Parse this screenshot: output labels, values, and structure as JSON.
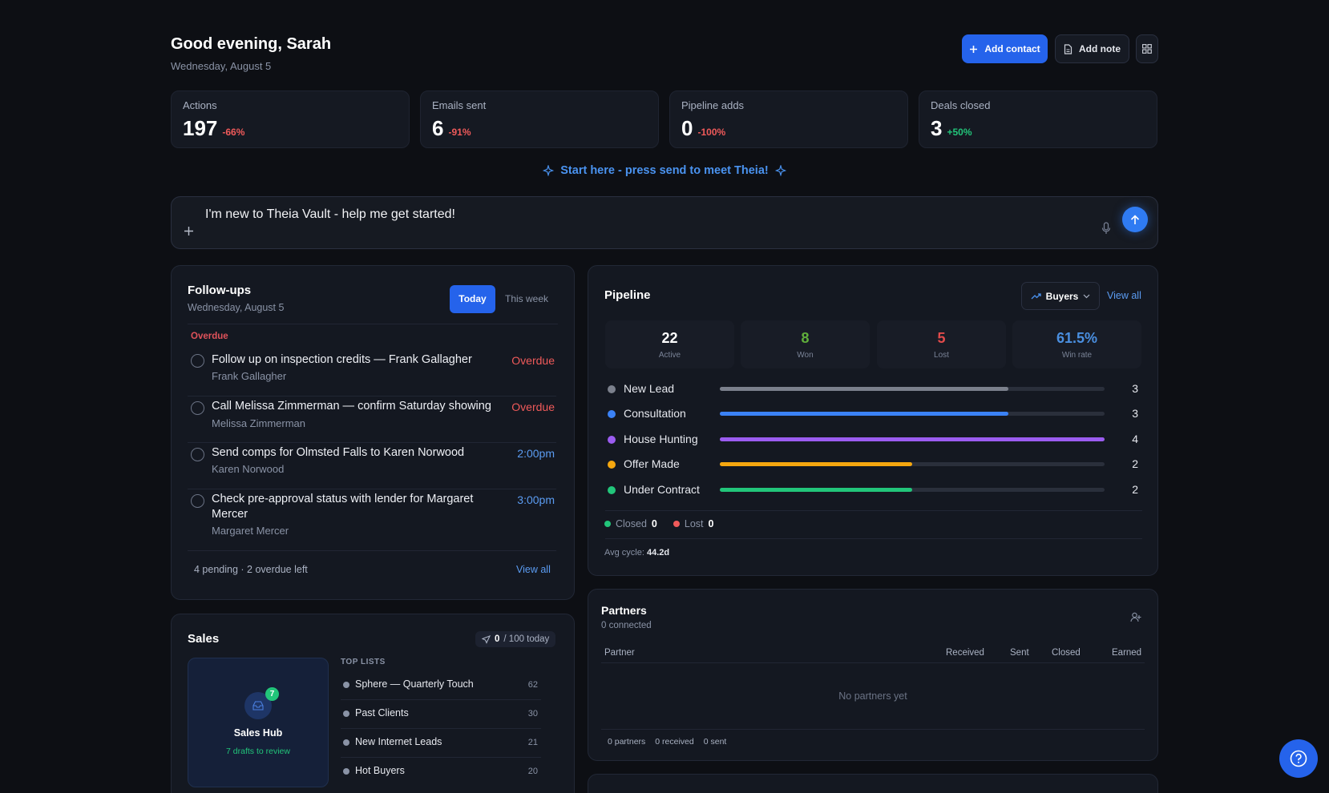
{
  "header": {
    "greeting": "Good evening, Sarah",
    "date": "Wednesday, August 5",
    "add_contact": "Add contact",
    "add_note": "Add note"
  },
  "stats": [
    {
      "label": "Actions",
      "value": "197",
      "delta": "-66%"
    },
    {
      "label": "Emails sent",
      "value": "6",
      "delta": "-91%"
    },
    {
      "label": "Pipeline adds",
      "value": "0",
      "delta": "-100%"
    },
    {
      "label": "Deals closed",
      "value": "3",
      "delta": "+50%"
    }
  ],
  "assistant": {
    "banner": "Start here - press send to meet Theia!",
    "prompt": "I'm new to Theia Vault - help me get started!"
  },
  "followups": {
    "title": "Follow-ups",
    "date": "Wednesday, August 5",
    "tab_today": "Today",
    "tab_week": "This week",
    "section": "Overdue",
    "tasks": [
      {
        "title": "Follow up on inspection credits — Frank Gallagher",
        "contact": "Frank Gallagher",
        "status": "Overdue"
      },
      {
        "title": "Call Melissa Zimmerman — confirm Saturday showing",
        "contact": "Melissa Zimmerman",
        "status": "Overdue"
      },
      {
        "title": "Send comps for Olmsted Falls to Karen Norwood",
        "contact": "Karen Norwood",
        "status": "2:00pm"
      },
      {
        "title": "Check pre-approval status with lender for Margaret Mercer",
        "contact": "Margaret Mercer",
        "status": "3:00pm"
      }
    ],
    "footer": "4 pending · 2 overdue left",
    "view_all": "View all"
  },
  "pipeline": {
    "title": "Pipeline",
    "filter": "Buyers",
    "view_all": "View all",
    "stats": [
      {
        "value": "22",
        "label": "Active",
        "color": "#ffffff"
      },
      {
        "value": "8",
        "label": "Won",
        "color": "#5fae3b"
      },
      {
        "value": "5",
        "label": "Lost",
        "color": "#e24b4b"
      },
      {
        "value": "61.5%",
        "label": "Win rate",
        "color": "#4a8fe0"
      }
    ],
    "stages": [
      {
        "name": "New Lead",
        "count": "3",
        "fraction": 0.75,
        "color": "#7b808c"
      },
      {
        "name": "Consultation",
        "count": "3",
        "fraction": 0.75,
        "color": "#3b82f6"
      },
      {
        "name": "House Hunting",
        "count": "4",
        "fraction": 1.0,
        "color": "#9b5cf0"
      },
      {
        "name": "Offer Made",
        "count": "2",
        "fraction": 0.5,
        "color": "#f5a70f"
      },
      {
        "name": "Under Contract",
        "count": "2",
        "fraction": 0.5,
        "color": "#22c57a"
      }
    ],
    "closed_label": "Closed",
    "closed_value": "0",
    "lost_label": "Lost",
    "lost_value": "0",
    "avg_cycle_label": "Avg cycle:",
    "avg_cycle_value": "44.2d"
  },
  "sales": {
    "title": "Sales",
    "sent_count": "0",
    "sent_limit": "/ 100 today",
    "hub_title": "Sales Hub",
    "hub_sub": "7 drafts to review",
    "hub_badge": "7",
    "lists_header": "TOP LISTS",
    "lists": [
      {
        "name": "Sphere — Quarterly Touch",
        "count": "62"
      },
      {
        "name": "Past Clients",
        "count": "30"
      },
      {
        "name": "New Internet Leads",
        "count": "21"
      },
      {
        "name": "Hot Buyers",
        "count": "20"
      }
    ]
  },
  "partners": {
    "title": "Partners",
    "subtitle": "0 connected",
    "columns": [
      "Partner",
      "Received",
      "Sent",
      "Closed",
      "Earned"
    ],
    "empty": "No partners yet",
    "footer": [
      "0 partners",
      "0 received",
      "0 sent"
    ]
  },
  "colors": {
    "accent": "#2563eb",
    "overdue": "#f05a5a",
    "time": "#5b9cf2"
  }
}
